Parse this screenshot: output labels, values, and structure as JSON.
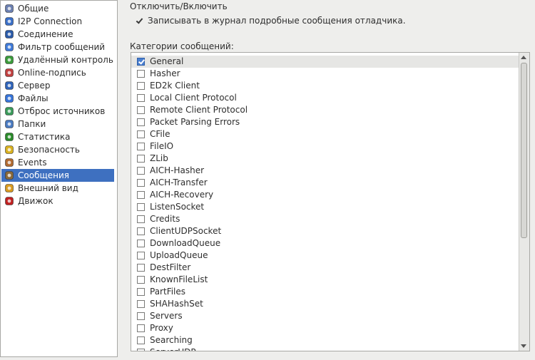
{
  "sidebar": {
    "items": [
      {
        "label": "Общие",
        "icon": "gear-icon",
        "color": "#6b7fb0"
      },
      {
        "label": "I2P Connection",
        "icon": "network-icon",
        "color": "#3a6fc7"
      },
      {
        "label": "Соединение",
        "icon": "connection-icon",
        "color": "#2a5aa8"
      },
      {
        "label": "Фильтр сообщений",
        "icon": "filter-icon",
        "color": "#3f7ad8"
      },
      {
        "label": "Удалённый контроль",
        "icon": "remote-control-icon",
        "color": "#3a9a3a"
      },
      {
        "label": "Online-подпись",
        "icon": "signature-icon",
        "color": "#c04040"
      },
      {
        "label": "Сервер",
        "icon": "server-icon",
        "color": "#2f63b8"
      },
      {
        "label": "Файлы",
        "icon": "files-icon",
        "color": "#3573d8"
      },
      {
        "label": "Отброс источников",
        "icon": "sources-icon",
        "color": "#3a9a5a"
      },
      {
        "label": "Папки",
        "icon": "folders-icon",
        "color": "#4a7ac0"
      },
      {
        "label": "Статистика",
        "icon": "statistics-icon",
        "color": "#2a8a2a"
      },
      {
        "label": "Безопасность",
        "icon": "lock-icon",
        "color": "#d8b020"
      },
      {
        "label": "Events",
        "icon": "events-icon",
        "color": "#b06a30"
      },
      {
        "label": "Сообщения",
        "icon": "messages-icon",
        "color": "#8a6a3a",
        "selected": true
      },
      {
        "label": "Внешний вид",
        "icon": "appearance-icon",
        "color": "#d89a20"
      },
      {
        "label": "Движок",
        "icon": "engine-icon",
        "color": "#c02020"
      }
    ]
  },
  "toggle_section": {
    "title": "Отключить/Включить",
    "debug_label": "Записывать в журнал подробные сообщения отладчика.",
    "debug_checked": true
  },
  "categories": {
    "title": "Категории сообщений:",
    "items": [
      {
        "label": "General",
        "checked": true
      },
      {
        "label": "Hasher",
        "checked": false
      },
      {
        "label": "ED2k Client",
        "checked": false
      },
      {
        "label": "Local Client Protocol",
        "checked": false
      },
      {
        "label": "Remote Client Protocol",
        "checked": false
      },
      {
        "label": "Packet Parsing Errors",
        "checked": false
      },
      {
        "label": "CFile",
        "checked": false
      },
      {
        "label": "FileIO",
        "checked": false
      },
      {
        "label": "ZLib",
        "checked": false
      },
      {
        "label": "AICH-Hasher",
        "checked": false
      },
      {
        "label": "AICH-Transfer",
        "checked": false
      },
      {
        "label": "AICH-Recovery",
        "checked": false
      },
      {
        "label": "ListenSocket",
        "checked": false
      },
      {
        "label": "Credits",
        "checked": false
      },
      {
        "label": "ClientUDPSocket",
        "checked": false
      },
      {
        "label": "DownloadQueue",
        "checked": false
      },
      {
        "label": "UploadQueue",
        "checked": false
      },
      {
        "label": "DestFilter",
        "checked": false
      },
      {
        "label": "KnownFileList",
        "checked": false
      },
      {
        "label": "PartFiles",
        "checked": false
      },
      {
        "label": "SHAHashSet",
        "checked": false
      },
      {
        "label": "Servers",
        "checked": false
      },
      {
        "label": "Proxy",
        "checked": false
      },
      {
        "label": "Searching",
        "checked": false
      },
      {
        "label": "ServerUDP",
        "checked": false
      }
    ]
  }
}
